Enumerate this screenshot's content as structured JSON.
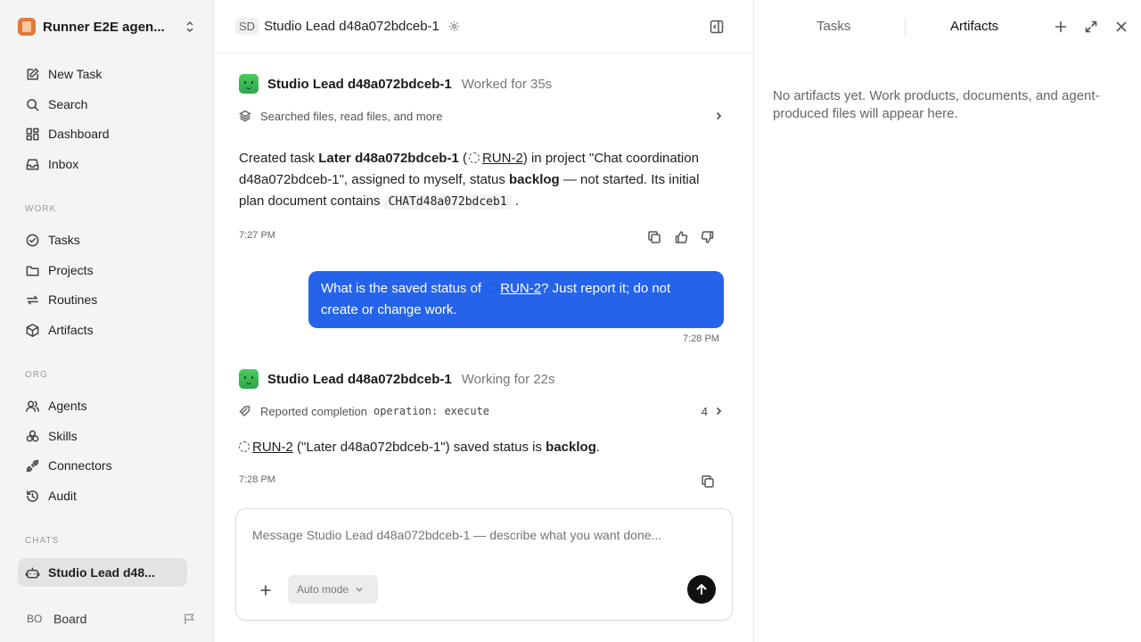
{
  "sidebar": {
    "workspace_name": "Runner E2E agen...",
    "nav_top": [
      {
        "label": "New Task",
        "icon": "new-task-icon"
      },
      {
        "label": "Search",
        "icon": "search-icon"
      },
      {
        "label": "Dashboard",
        "icon": "dashboard-icon"
      },
      {
        "label": "Inbox",
        "icon": "inbox-icon"
      }
    ],
    "section_work": "WORK",
    "nav_work": [
      {
        "label": "Tasks",
        "icon": "tasks-icon"
      },
      {
        "label": "Projects",
        "icon": "folder-icon"
      },
      {
        "label": "Routines",
        "icon": "routines-icon"
      },
      {
        "label": "Artifacts",
        "icon": "box-icon"
      }
    ],
    "section_org": "ORG",
    "nav_org": [
      {
        "label": "Agents",
        "icon": "agents-icon"
      },
      {
        "label": "Skills",
        "icon": "skills-icon"
      },
      {
        "label": "Connectors",
        "icon": "plug-icon"
      },
      {
        "label": "Audit",
        "icon": "history-icon"
      }
    ],
    "section_chats": "CHATS",
    "chats": [
      {
        "label": "Studio Lead d48...",
        "icon": "bot-icon"
      }
    ],
    "board_initials": "BO",
    "board_label": "Board"
  },
  "header": {
    "initials": "SD",
    "title": "Studio Lead d48a072bdceb-1"
  },
  "messages": {
    "first": {
      "agent": "Studio Lead d48a072bdceb-1",
      "status": "Worked for 35s",
      "activity": "Searched files, read files, and more",
      "text_1": "Created task ",
      "task_name": "Later d48a072bdceb-1",
      "text_2": " (",
      "run_id": "RUN-2",
      "text_3": ") in project \"Chat coordination d48a072bdceb-1\", assigned to myself, status ",
      "status_word": "backlog",
      "text_4": " — not started. Its initial plan document contains ",
      "code": "CHATd48a072bdceb1",
      "text_5": " .",
      "time": "7:27 PM"
    },
    "user": {
      "text_1": "What is the saved status of ",
      "run_id": "RUN-2",
      "text_2": "? Just report it; do not create or change work.",
      "time": "7:28 PM"
    },
    "second": {
      "agent": "Studio Lead d48a072bdceb-1",
      "status": "Working for 22s",
      "activity": "Reported completion",
      "activity_code": "operation: execute",
      "activity_count": "4",
      "run_id": "RUN-2",
      "text_1": " (\"Later d48a072bdceb-1\") saved status is ",
      "status_word": "backlog",
      "text_2": ".",
      "time": "7:28 PM"
    }
  },
  "composer": {
    "placeholder": "Message Studio Lead d48a072bdceb-1 — describe what you want done...",
    "mode_label": "Auto mode"
  },
  "right_panel": {
    "tab_tasks": "Tasks",
    "tab_artifacts": "Artifacts",
    "empty_text": "No artifacts yet. Work products, documents, and agent-produced files will appear here."
  },
  "colors": {
    "accent": "#2563eb",
    "sidebar_bg": "#f4f4f5",
    "agent_avatar": "#3cba54"
  }
}
